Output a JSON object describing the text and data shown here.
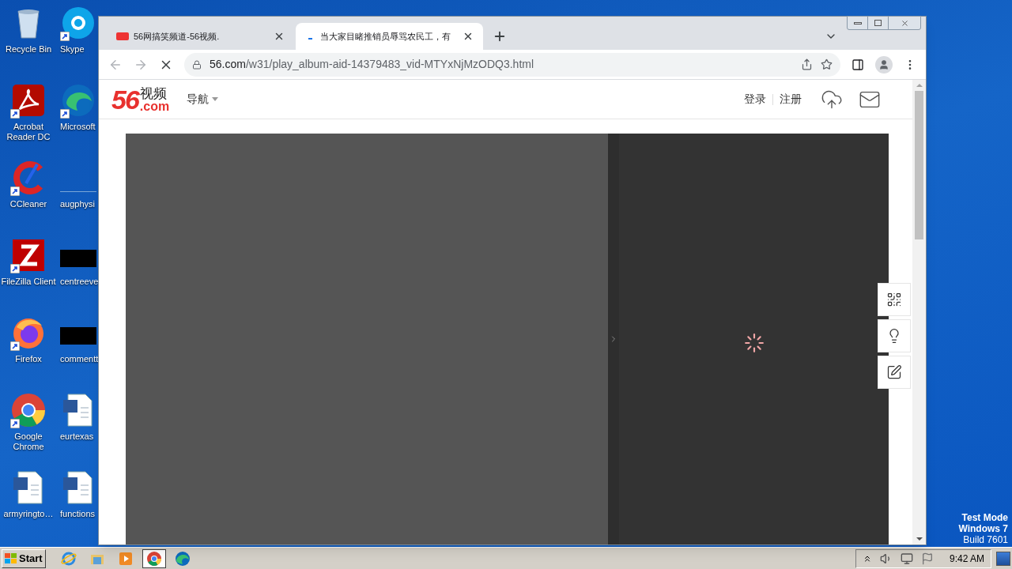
{
  "desktop_icons": [
    {
      "label": "Recycle Bin",
      "kind": "recycle-bin",
      "shortcut": false
    },
    {
      "label": "Skype",
      "kind": "skype",
      "shortcut": true
    },
    {
      "label": "Acrobat Reader DC",
      "kind": "acrobat",
      "shortcut": true
    },
    {
      "label": "Microsoft",
      "kind": "edge",
      "shortcut": true
    },
    {
      "label": "CCleaner",
      "kind": "ccleaner",
      "shortcut": true
    },
    {
      "label": "augphysi",
      "kind": "blank",
      "shortcut": false
    },
    {
      "label": "FileZilla Client",
      "kind": "filezilla",
      "shortcut": true
    },
    {
      "label": "centreeve",
      "kind": "black",
      "shortcut": false
    },
    {
      "label": "Firefox",
      "kind": "firefox",
      "shortcut": true
    },
    {
      "label": "commentt",
      "kind": "black",
      "shortcut": false
    },
    {
      "label": "Google Chrome",
      "kind": "chrome",
      "shortcut": true
    },
    {
      "label": "eurtexas",
      "kind": "word",
      "shortcut": false
    },
    {
      "label": "armyringto…",
      "kind": "word",
      "shortcut": false
    },
    {
      "label": "functions",
      "kind": "word",
      "shortcut": false
    }
  ],
  "browser": {
    "tabs": [
      {
        "title": "56网搞笑频道-56视频.",
        "selected": false,
        "loading": false
      },
      {
        "title": "当大家目睹推销员辱骂农民工，有",
        "selected": true,
        "loading": true
      }
    ],
    "loading": true,
    "url": {
      "domain": "56.com",
      "path": "/w31/play_album-aid-14379483_vid-MTYxNjMzODQ3.html"
    }
  },
  "site": {
    "logo": {
      "number": "56",
      "name": "视频",
      "suffix": ".com"
    },
    "nav": "导航",
    "login": "登录",
    "register": "注册"
  },
  "taskbar": {
    "start": "Start",
    "programs": [
      {
        "kind": "ie",
        "selected": false
      },
      {
        "kind": "explorer",
        "selected": false
      },
      {
        "kind": "media",
        "selected": false
      },
      {
        "kind": "chrome",
        "selected": true
      },
      {
        "kind": "edge",
        "selected": false
      }
    ],
    "clock": "9:42 AM"
  },
  "watermark": [
    "Test Mode",
    "Windows 7",
    "Build 7601"
  ]
}
